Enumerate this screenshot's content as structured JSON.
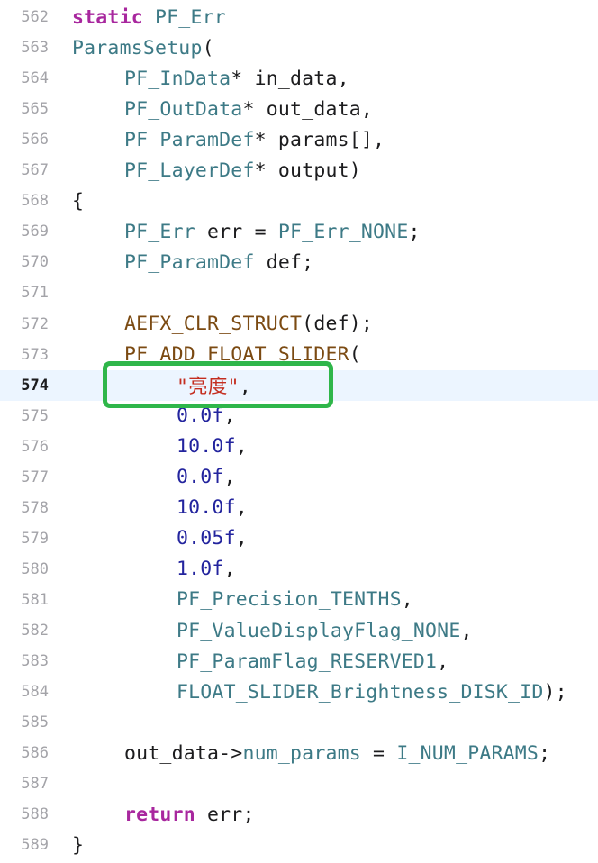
{
  "editor": {
    "current_line": "574",
    "lines": [
      {
        "num": "562",
        "indent": 0,
        "tokens": [
          {
            "t": "static",
            "c": "kw"
          },
          {
            "t": " PF_Err",
            "c": "type"
          }
        ]
      },
      {
        "num": "563",
        "indent": 0,
        "tokens": [
          {
            "t": "ParamsSetup",
            "c": "type"
          },
          {
            "t": "(",
            "c": "plain"
          }
        ]
      },
      {
        "num": "564",
        "indent": 1,
        "tokens": [
          {
            "t": "PF_InData",
            "c": "type"
          },
          {
            "t": "* in_data,",
            "c": "plain"
          }
        ]
      },
      {
        "num": "565",
        "indent": 1,
        "tokens": [
          {
            "t": "PF_OutData",
            "c": "type"
          },
          {
            "t": "* out_data,",
            "c": "plain"
          }
        ]
      },
      {
        "num": "566",
        "indent": 1,
        "tokens": [
          {
            "t": "PF_ParamDef",
            "c": "type"
          },
          {
            "t": "* params[],",
            "c": "plain"
          }
        ]
      },
      {
        "num": "567",
        "indent": 1,
        "tokens": [
          {
            "t": "PF_LayerDef",
            "c": "type"
          },
          {
            "t": "* output)",
            "c": "plain"
          }
        ]
      },
      {
        "num": "568",
        "indent": 0,
        "tokens": [
          {
            "t": "{",
            "c": "plain"
          }
        ]
      },
      {
        "num": "569",
        "indent": 1,
        "tokens": [
          {
            "t": "PF_Err",
            "c": "type"
          },
          {
            "t": " err = ",
            "c": "plain"
          },
          {
            "t": "PF_Err_NONE",
            "c": "const"
          },
          {
            "t": ";",
            "c": "plain"
          }
        ]
      },
      {
        "num": "570",
        "indent": 1,
        "tokens": [
          {
            "t": "PF_ParamDef",
            "c": "type"
          },
          {
            "t": " def;",
            "c": "plain"
          }
        ]
      },
      {
        "num": "571",
        "indent": 0,
        "tokens": []
      },
      {
        "num": "572",
        "indent": 1,
        "tokens": [
          {
            "t": "AEFX_CLR_STRUCT",
            "c": "macro"
          },
          {
            "t": "(def);",
            "c": "plain"
          }
        ]
      },
      {
        "num": "573",
        "indent": 1,
        "tokens": [
          {
            "t": "PF_ADD_FLOAT_SLIDER",
            "c": "macro"
          },
          {
            "t": "(",
            "c": "plain"
          }
        ]
      },
      {
        "num": "574",
        "indent": 2,
        "tokens": [
          {
            "t": "\"亮度\"",
            "c": "str"
          },
          {
            "t": ",",
            "c": "plain"
          }
        ]
      },
      {
        "num": "575",
        "indent": 2,
        "tokens": [
          {
            "t": "0.0f",
            "c": "num"
          },
          {
            "t": ",",
            "c": "plain"
          }
        ]
      },
      {
        "num": "576",
        "indent": 2,
        "tokens": [
          {
            "t": "10.0f",
            "c": "num"
          },
          {
            "t": ",",
            "c": "plain"
          }
        ]
      },
      {
        "num": "577",
        "indent": 2,
        "tokens": [
          {
            "t": "0.0f",
            "c": "num"
          },
          {
            "t": ",",
            "c": "plain"
          }
        ]
      },
      {
        "num": "578",
        "indent": 2,
        "tokens": [
          {
            "t": "10.0f",
            "c": "num"
          },
          {
            "t": ",",
            "c": "plain"
          }
        ]
      },
      {
        "num": "579",
        "indent": 2,
        "tokens": [
          {
            "t": "0.05f",
            "c": "num"
          },
          {
            "t": ",",
            "c": "plain"
          }
        ]
      },
      {
        "num": "580",
        "indent": 2,
        "tokens": [
          {
            "t": "1.0f",
            "c": "num"
          },
          {
            "t": ",",
            "c": "plain"
          }
        ]
      },
      {
        "num": "581",
        "indent": 2,
        "tokens": [
          {
            "t": "PF_Precision_TENTHS",
            "c": "const"
          },
          {
            "t": ",",
            "c": "plain"
          }
        ]
      },
      {
        "num": "582",
        "indent": 2,
        "tokens": [
          {
            "t": "PF_ValueDisplayFlag_NONE",
            "c": "const"
          },
          {
            "t": ",",
            "c": "plain"
          }
        ]
      },
      {
        "num": "583",
        "indent": 2,
        "tokens": [
          {
            "t": "PF_ParamFlag_RESERVED1",
            "c": "const"
          },
          {
            "t": ",",
            "c": "plain"
          }
        ]
      },
      {
        "num": "584",
        "indent": 2,
        "tokens": [
          {
            "t": "FLOAT_SLIDER_Brightness_DISK_ID",
            "c": "const"
          },
          {
            "t": ");",
            "c": "plain"
          }
        ]
      },
      {
        "num": "585",
        "indent": 0,
        "tokens": []
      },
      {
        "num": "586",
        "indent": 1,
        "tokens": [
          {
            "t": "out_data->",
            "c": "plain"
          },
          {
            "t": "num_params",
            "c": "field"
          },
          {
            "t": " = ",
            "c": "plain"
          },
          {
            "t": "I_NUM_PARAMS",
            "c": "const"
          },
          {
            "t": ";",
            "c": "plain"
          }
        ]
      },
      {
        "num": "587",
        "indent": 0,
        "tokens": []
      },
      {
        "num": "588",
        "indent": 1,
        "tokens": [
          {
            "t": "return",
            "c": "kw"
          },
          {
            "t": " err;",
            "c": "plain"
          }
        ]
      },
      {
        "num": "589",
        "indent": 0,
        "tokens": [
          {
            "t": "}",
            "c": "plain"
          }
        ]
      }
    ]
  },
  "colors": {
    "keyword": "#a8279e",
    "type": "#3d7a86",
    "number": "#23249e",
    "string": "#c42d1f",
    "macro": "#7b4a12",
    "current_line_bg": "#ecf5ff",
    "highlight_border": "#2fb64a"
  }
}
